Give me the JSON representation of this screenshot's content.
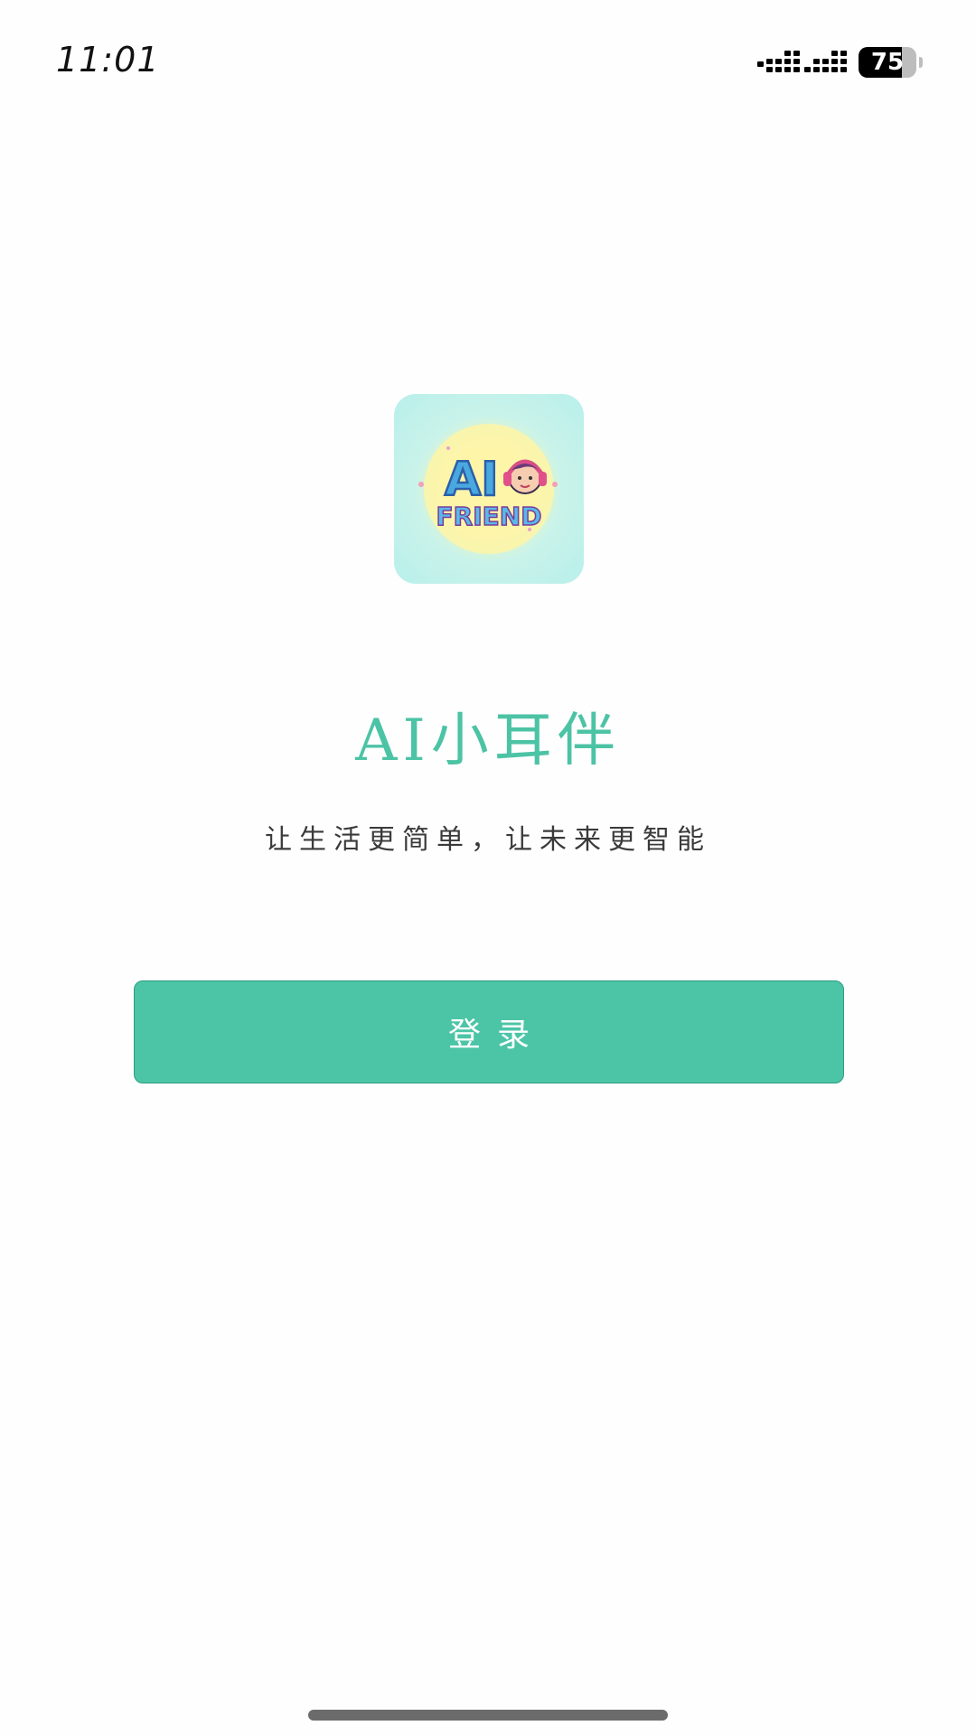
{
  "status_bar": {
    "time": "11:01",
    "battery_percent": "75",
    "battery_level": 0.75
  },
  "logo": {
    "line1": "AI",
    "line2": "FRIEND",
    "icon": "headphone-kid-logo-icon"
  },
  "app": {
    "title": "AI小耳伴",
    "subtitle": "让生活更简单，让未来更智能"
  },
  "actions": {
    "login_label": "登录"
  },
  "colors": {
    "accent": "#4cc5a7",
    "title": "#4cc3a5",
    "background": "#fefefe"
  }
}
